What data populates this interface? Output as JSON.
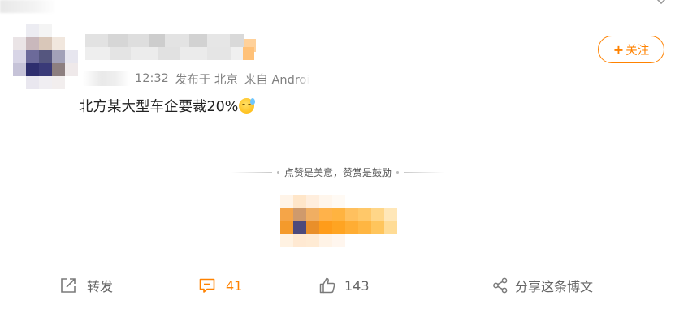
{
  "post": {
    "meta": {
      "time": "12:32",
      "posted_at": "发布于 北京",
      "source": "来自 Androi"
    },
    "content": {
      "text": "北方某大型车企要裁20%",
      "emoji": "sweat-smile-emoji"
    },
    "follow": {
      "plus": "+",
      "label": "关注"
    },
    "reward": {
      "slogan": "点赞是美意，赞赏是鼓励"
    },
    "actions": {
      "repost_label": "转发",
      "comment_count": "41",
      "like_count": "143",
      "share_label": "分享这条博文"
    },
    "icons": {
      "repost": "repost-icon",
      "comment": "comment-icon",
      "like": "thumbs-up-icon",
      "share": "share-icon",
      "chevron": "chevron-down-icon"
    },
    "colors": {
      "accent": "#ff8200",
      "muted_text": "#808080",
      "body_text": "#222222"
    }
  }
}
